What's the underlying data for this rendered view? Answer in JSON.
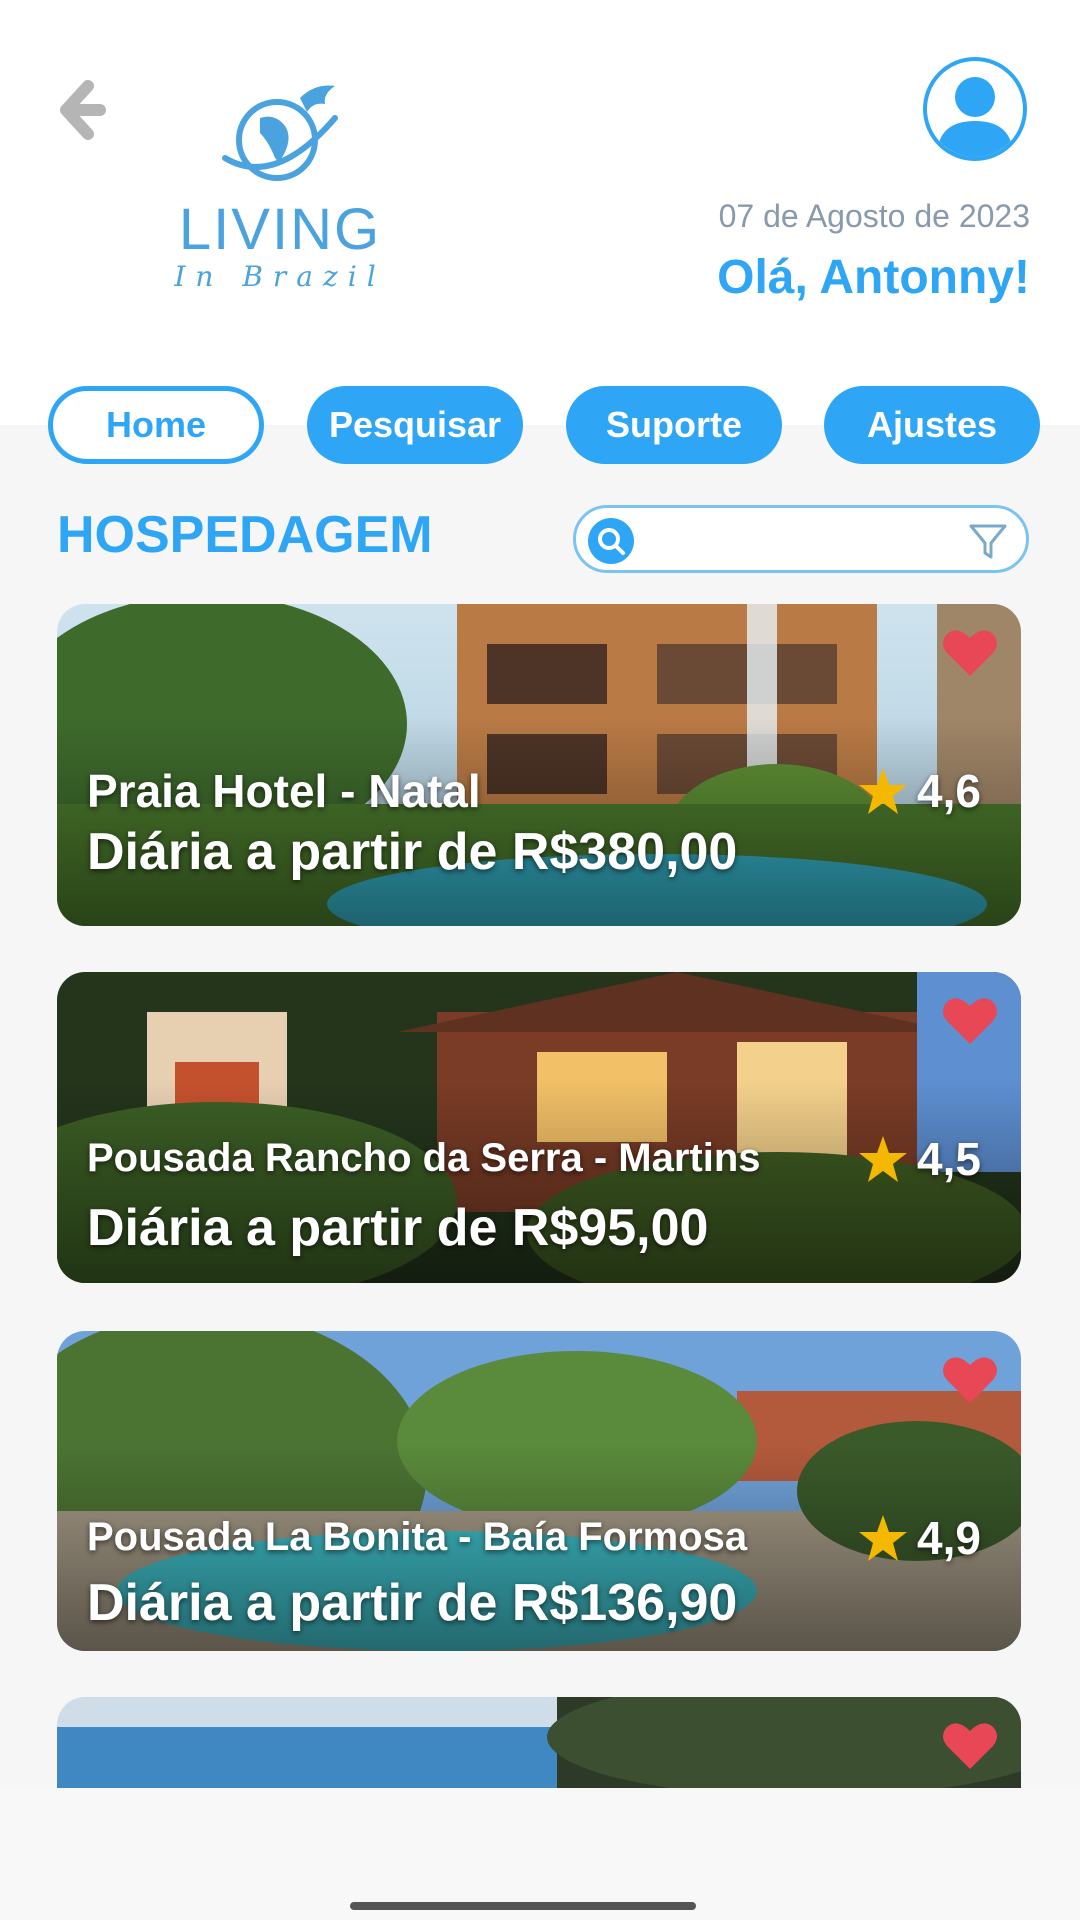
{
  "header": {
    "logo_title": "LIVING",
    "logo_subtitle": "In Brazil",
    "date": "07 de Agosto de 2023",
    "greeting": "Olá, Antonny!"
  },
  "tabs": [
    {
      "label": "Home",
      "active": true
    },
    {
      "label": "Pesquisar",
      "active": false
    },
    {
      "label": "Suporte",
      "active": false
    },
    {
      "label": "Ajustes",
      "active": false
    }
  ],
  "section": {
    "title": "HOSPEDAGEM",
    "search_placeholder": ""
  },
  "listings": [
    {
      "name": "Praia Hotel - Natal",
      "price": "Diária a partir de R$380,00",
      "rating": "4,6",
      "favorite": true
    },
    {
      "name": "Pousada Rancho da Serra - Martins",
      "price": "Diária a partir de R$95,00",
      "rating": "4,5",
      "favorite": true
    },
    {
      "name": "Pousada La Bonita - Baía Formosa",
      "price": "Diária a partir de R$136,90",
      "rating": "4,9",
      "favorite": true
    },
    {
      "name": "",
      "price": "",
      "rating": "",
      "favorite": true
    }
  ],
  "colors": {
    "accent": "#2fa6f5",
    "heart": "#e84855",
    "star": "#f5b800",
    "date_text": "#8a9aad"
  },
  "icons": [
    "back-arrow-icon",
    "profile-icon",
    "search-icon",
    "filter-icon",
    "heart-icon",
    "star-icon"
  ]
}
